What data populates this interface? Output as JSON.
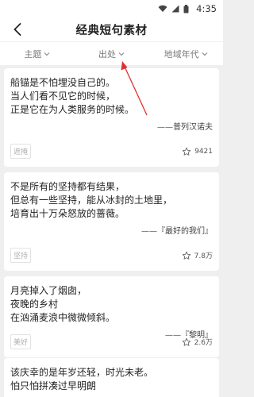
{
  "status_bar": {
    "time": "4:35"
  },
  "app_bar": {
    "title": "经典短句素材"
  },
  "filters": [
    {
      "label": "主题"
    },
    {
      "label": "出处"
    },
    {
      "label": "地域年代"
    }
  ],
  "quotes": [
    {
      "text": "船锚是不怕埋没自己的。\n当人们看不见它的时候，\n正是它在为人类服务的时候。",
      "source": "——普列汉诺夫",
      "tag": "遮掩",
      "likes": "9421"
    },
    {
      "text": "不是所有的坚持都有结果，\n但总有一些坚持，能从冰封的土地里，\n培育出十万朵怒放的蔷薇。",
      "source": "——『最好的我们』",
      "tag": "坚持",
      "likes": "7.8万"
    },
    {
      "text": "月亮掉入了烟囱，\n夜晚的乡村\n在汹涌麦浪中微微倾斜。",
      "source": "——『黎明』",
      "tag": "美好",
      "likes": "2.6万"
    },
    {
      "text": "该庆幸的是年岁还轻，时光未老。\n怕只怕拼凑过早明朗",
      "source": "",
      "tag": "",
      "likes": ""
    }
  ],
  "colors": {
    "annotation_arrow": "#e03030",
    "tag_border": "#e2e2e2"
  },
  "icons": [
    "back-arrow-icon",
    "wifi-icon",
    "signal-icon",
    "battery-icon",
    "chevron-down-icon",
    "star-outline-icon"
  ]
}
